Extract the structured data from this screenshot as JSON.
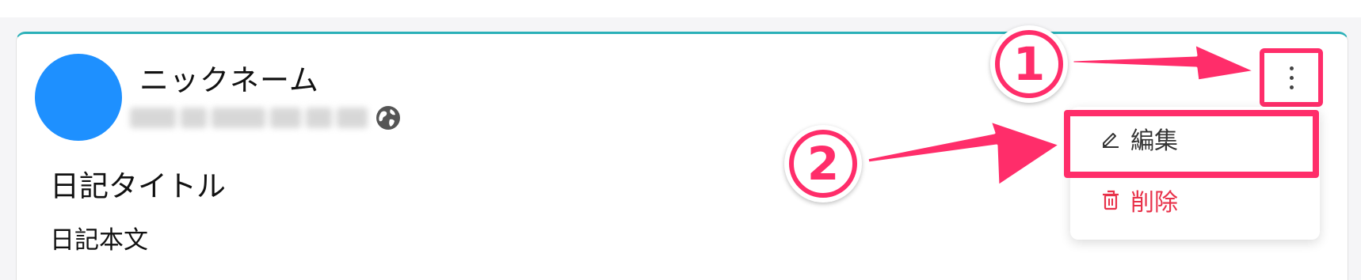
{
  "post": {
    "nickname": "ニックネーム",
    "title": "日記タイトル",
    "body": "日記本文"
  },
  "menu": {
    "edit_label": "編集",
    "delete_label": "削除"
  },
  "annotations": {
    "step1": "1",
    "step2": "2"
  },
  "colors": {
    "accent_border": "#2ab0b8",
    "avatar": "#1e90ff",
    "highlight": "#ff2d6a",
    "delete_text": "#e8324a"
  },
  "icons": {
    "visibility": "globe-icon",
    "menu": "more-vertical-icon",
    "edit": "pencil-icon",
    "delete": "trash-icon"
  }
}
